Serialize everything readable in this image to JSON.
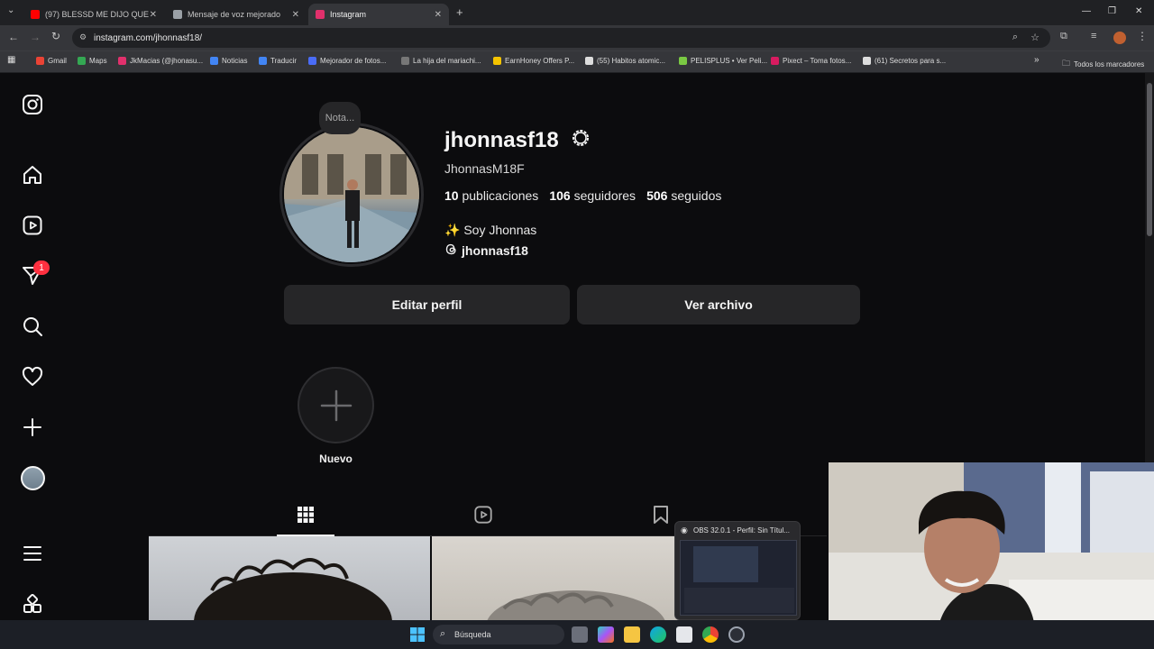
{
  "browser": {
    "tabs": [
      {
        "title": "(97) BLESSD ME DIJO QUE",
        "color": "#ff0000"
      },
      {
        "title": "Mensaje de voz mejorado",
        "color": "#9aa0a6"
      },
      {
        "title": "Instagram",
        "color": "#e1306c"
      }
    ],
    "url": "instagram.com/jhonnasf18/",
    "bookmarks": [
      {
        "label": "Gmail",
        "color": "#ea4335"
      },
      {
        "label": "Maps",
        "color": "#34a853"
      },
      {
        "label": "JkMacias (@jhonasu...",
        "color": "#e1306c"
      },
      {
        "label": "Noticias",
        "color": "#4285f4"
      },
      {
        "label": "Traducir",
        "color": "#4285f4"
      },
      {
        "label": "Mejorador de fotos...",
        "color": "#4a6cf7"
      },
      {
        "label": "La hija del mariachi...",
        "color": "#777777"
      },
      {
        "label": "EarnHoney Offers P...",
        "color": "#f5c400"
      },
      {
        "label": "(55) Habitos atomic...",
        "color": "#dddddd"
      },
      {
        "label": "PELISPLUS • Ver Peli...",
        "color": "#7ac943"
      },
      {
        "label": "Pixect – Toma fotos...",
        "color": "#d81b60"
      },
      {
        "label": "(61) Secretos para s...",
        "color": "#dddddd"
      }
    ],
    "all_bookmarks": "Todos los marcadores"
  },
  "sidebar": {
    "notification_count": "1"
  },
  "profile": {
    "note": "Nota...",
    "username": "jhonnasf18",
    "full_name": "JhonnasM18F",
    "posts_count": "10",
    "posts_label": "publicaciones",
    "followers_count": "106",
    "followers_label": "seguidores",
    "following_count": "506",
    "following_label": "seguidos",
    "bio": "✨ Soy Jhonnas",
    "threads_handle": "jhonnasf18",
    "edit_button": "Editar perfil",
    "archive_button": "Ver archivo",
    "new_highlight": "Nuevo"
  },
  "obs_preview": {
    "title": "OBS 32.0.1 - Perfil: Sin Títul..."
  },
  "taskbar": {
    "search_label": "Búsqueda"
  }
}
